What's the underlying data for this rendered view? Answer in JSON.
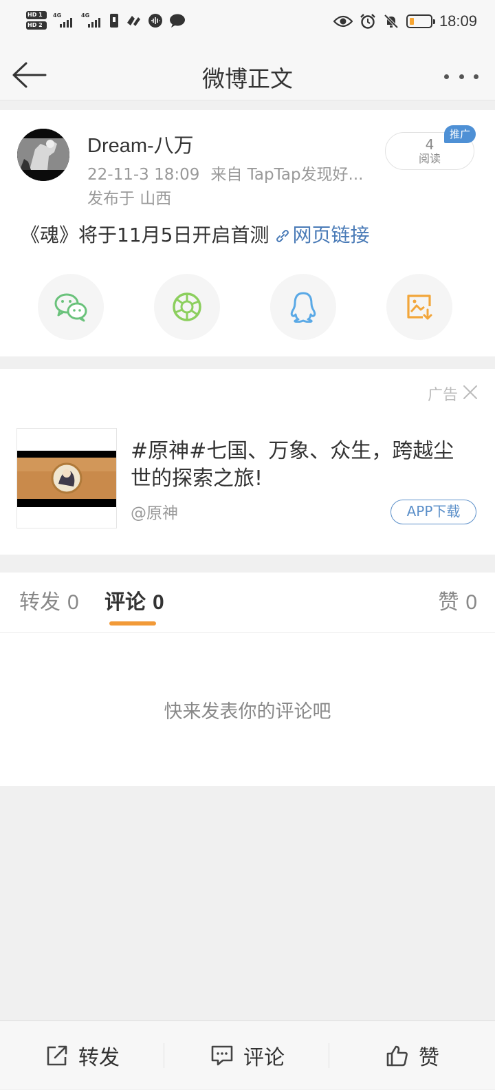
{
  "status_bar": {
    "hd1": "HD 1",
    "hd2": "HD 2",
    "sim1_network": "4G",
    "sim2_network": "4G",
    "time": "18:09",
    "battery_level": 0.2,
    "icons": [
      "sim-icon",
      "hd-call-icon",
      "audio-icon",
      "message-icon",
      "eye-comfort-icon",
      "alarm-icon",
      "mute-icon",
      "battery-icon"
    ]
  },
  "nav": {
    "title": "微博正文",
    "back_icon": "back-arrow-icon",
    "more_icon": "more-icon"
  },
  "post": {
    "author": "Dream-八万",
    "date": "22-11-3 18:09",
    "source": "来自 TapTap发现好...",
    "location": "发布于 山西",
    "read_count": "4",
    "read_label": "阅读",
    "promo_tag": "推广",
    "text": "《魂》将于11月5日开启首测",
    "link_text": "网页链接",
    "link_color": "#4a7bb7",
    "share_targets": [
      {
        "name": "wechat",
        "icon": "wechat-icon",
        "color": "#6ac27b"
      },
      {
        "name": "moments",
        "icon": "moments-icon",
        "color": "#8ccf5e"
      },
      {
        "name": "qq",
        "icon": "qq-icon",
        "color": "#5aa9e6"
      },
      {
        "name": "save-image",
        "icon": "save-image-icon",
        "color": "#f2a63b"
      }
    ]
  },
  "ad": {
    "label": "广告",
    "title": "#原神#七国、万象、众生，跨越尘世的探索之旅!",
    "account": "@原神",
    "button": "APP下载"
  },
  "tabs": {
    "repost_label": "转发",
    "repost_count": "0",
    "comment_label": "评论",
    "comment_count": "0",
    "like_label": "赞",
    "like_count": "0",
    "active": "comment",
    "accent_color": "#f29a38"
  },
  "comments": {
    "empty_text": "快来发表你的评论吧"
  },
  "bottom_bar": {
    "repost": "转发",
    "comment": "评论",
    "like": "赞"
  }
}
